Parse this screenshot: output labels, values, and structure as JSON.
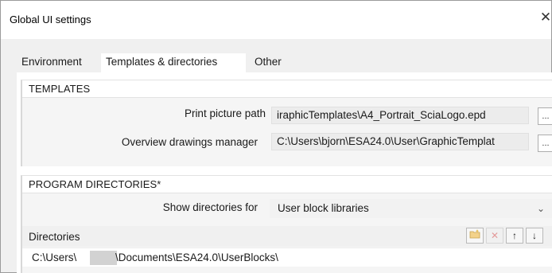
{
  "window": {
    "title": "Global UI settings",
    "close_glyph": "✕"
  },
  "tabs": [
    {
      "label": "Environment",
      "active": false
    },
    {
      "label": "Templates & directories",
      "active": true
    },
    {
      "label": "Other",
      "active": false
    }
  ],
  "templates": {
    "header": "TEMPLATES",
    "print_picture_path_label": "Print picture path",
    "print_picture_path_value": "iraphicTemplates\\A4_Portrait_SciaLogo.epd",
    "overview_label": "Overview drawings manager",
    "overview_value": "C:\\Users\\bjorn\\ESA24.0\\User\\GraphicTemplat",
    "browse_label": "..."
  },
  "program_directories": {
    "header": "PROGRAM DIRECTORIES*",
    "show_for_label": "Show directories for",
    "show_for_value": "User block libraries",
    "directories_label": "Directories",
    "toolbar": {
      "new_icon": "folder-new-icon",
      "delete_glyph": "✕",
      "up_glyph": "↑",
      "down_glyph": "↓"
    },
    "directory_entries": [
      {
        "prefix": "C:\\Users\\",
        "suffix": "\\Documents\\ESA24.0\\UserBlocks\\"
      }
    ]
  },
  "colors": {
    "accent_delete": "#e39a9a",
    "panel_bg": "#ffffff",
    "window_bg": "#f0f0f0"
  }
}
